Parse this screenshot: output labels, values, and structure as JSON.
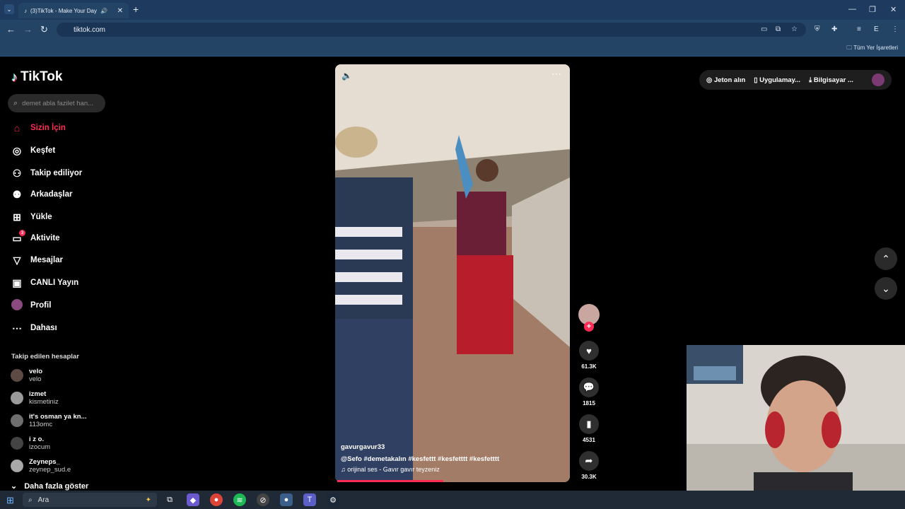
{
  "browser": {
    "tab_title": "(3)TikTok - Make Your Day",
    "url": "tiktok.com",
    "bookmarks_label": "Tüm Yer İşaretleri"
  },
  "tiktok": {
    "logo_text": "TikTok",
    "search_placeholder": "demet abla fazilet han...",
    "nav": [
      {
        "label": "Sizin İçin",
        "icon": "home-icon"
      },
      {
        "label": "Keşfet",
        "icon": "compass-icon"
      },
      {
        "label": "Takip ediliyor",
        "icon": "following-icon"
      },
      {
        "label": "Arkadaşlar",
        "icon": "friends-icon"
      },
      {
        "label": "Yükle",
        "icon": "upload-icon"
      },
      {
        "label": "Aktivite",
        "icon": "activity-icon",
        "badge": "3"
      },
      {
        "label": "Mesajlar",
        "icon": "messages-icon"
      },
      {
        "label": "CANLI Yayın",
        "icon": "live-icon"
      },
      {
        "label": "Profil",
        "icon": "profile-avatar"
      },
      {
        "label": "Dahası",
        "icon": "more-icon"
      }
    ],
    "following_title": "Takip edilen hesaplar",
    "following": [
      {
        "name": "velo",
        "user": "velo"
      },
      {
        "name": "izmet",
        "user": "kismetiniz"
      },
      {
        "name": "it's osman ya kn...",
        "user": "113omc"
      },
      {
        "name": "i z o.",
        "user": "izocum"
      },
      {
        "name": "Zeyneps_",
        "user": "zeynep_sud.e"
      }
    ],
    "show_more": "Daha fazla göster",
    "top_actions": {
      "coins": "Jeton alın",
      "app": "Uygulamay...",
      "desktop": "Bilgisayar ..."
    },
    "video": {
      "author": "gavurgavur33",
      "description": "@Sefo #demetakalın #kesfettt #kesfetttt #kesfetttt",
      "music": "♫ orijinal ses - Gavır gavır teyzeniz",
      "progress": 0.46,
      "likes": "61.3K",
      "comments": "1815",
      "saves": "4531",
      "shares": "30.3K"
    }
  },
  "taskbar": {
    "search_label": "Ara"
  },
  "colors": {
    "accent": "#fe2c55",
    "chrome": "#244466"
  }
}
